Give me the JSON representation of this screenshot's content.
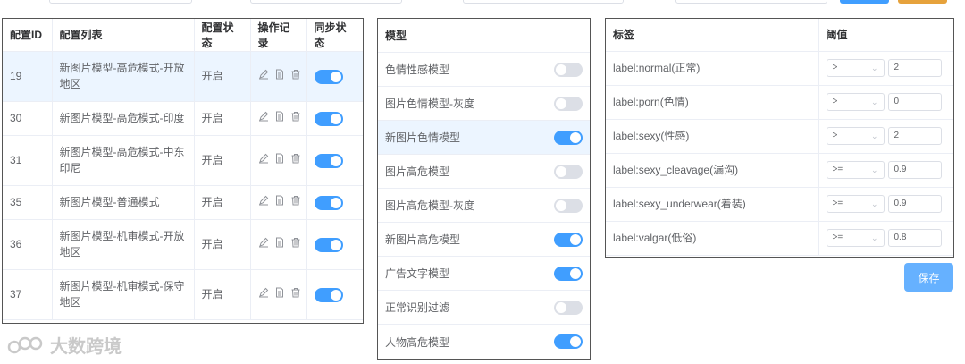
{
  "config_table": {
    "headers": [
      "配置ID",
      "配置列表",
      "配置状态",
      "操作记录",
      "同步状态"
    ],
    "rows": [
      {
        "id": "19",
        "name": "新图片模型-高危模式-开放地区",
        "status": "开启",
        "sync": true,
        "highlight": true
      },
      {
        "id": "30",
        "name": "新图片模型-高危模式-印度",
        "status": "开启",
        "sync": true,
        "highlight": false
      },
      {
        "id": "31",
        "name": "新图片模型-高危模式-中东印尼",
        "status": "开启",
        "sync": true,
        "highlight": false
      },
      {
        "id": "35",
        "name": "新图片模型-普通模式",
        "status": "开启",
        "sync": true,
        "highlight": false
      },
      {
        "id": "36",
        "name": "新图片模型-机审模式-开放地区",
        "status": "开启",
        "sync": true,
        "highlight": false
      },
      {
        "id": "37",
        "name": "新图片模型-机审模式-保守地区",
        "status": "开启",
        "sync": true,
        "highlight": false
      }
    ]
  },
  "model_panel": {
    "header": "模型",
    "items": [
      {
        "label": "色情性感模型",
        "on": false,
        "highlight": false
      },
      {
        "label": "图片色情模型-灰度",
        "on": false,
        "highlight": false
      },
      {
        "label": "新图片色情模型",
        "on": true,
        "highlight": true
      },
      {
        "label": "图片高危模型",
        "on": false,
        "highlight": false
      },
      {
        "label": "图片高危模型-灰度",
        "on": false,
        "highlight": false
      },
      {
        "label": "新图片高危模型",
        "on": true,
        "highlight": false
      },
      {
        "label": "广告文字模型",
        "on": true,
        "highlight": false
      },
      {
        "label": "正常识别过滤",
        "on": false,
        "highlight": false
      },
      {
        "label": "人物高危模型",
        "on": true,
        "highlight": false
      }
    ]
  },
  "threshold_panel": {
    "headers": [
      "标签",
      "阈值"
    ],
    "rows": [
      {
        "label": "label:normal(正常)",
        "op": ">",
        "value": "2"
      },
      {
        "label": "label:porn(色情)",
        "op": ">",
        "value": "0"
      },
      {
        "label": "label:sexy(性感)",
        "op": ">",
        "value": "2"
      },
      {
        "label": "label:sexy_cleavage(漏沟)",
        "op": ">=",
        "value": "0.9"
      },
      {
        "label": "label:sexy_underwear(着装)",
        "op": ">=",
        "value": "0.9"
      },
      {
        "label": "label:valgar(低俗)",
        "op": ">=",
        "value": "0.8"
      }
    ]
  },
  "save_label": "保存",
  "watermark_text": "大数跨境",
  "colors": {
    "accent": "#409eff",
    "switch_off": "#dcdfe6",
    "highlight_row": "#ecf5ff",
    "warning": "#e6a23c"
  }
}
